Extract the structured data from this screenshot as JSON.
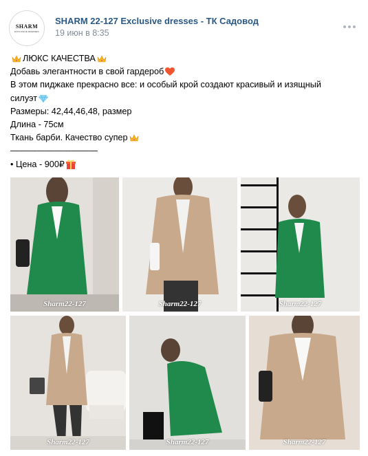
{
  "post": {
    "avatar_brand": "SHARM",
    "avatar_sub": "EXCLUSIVE DRESSES",
    "author": "SHARM 22-127 Exclusive dresses - ТК Садовод",
    "date": "19 июн в 8:35"
  },
  "text": {
    "line1": "ЛЮКС КАЧЕСТВА",
    "line2": "Добавь элегантности в свой гардероб",
    "line3": "В этом пиджаке прекрасно все: и особый крой создают красивый и изящный",
    "line4": "силуэт",
    "line5": "Размеры: 42,44,46,48, размер",
    "line6": "Длина - 75см",
    "line7": "Ткань барби. Качество супер",
    "line8": "——————————",
    "line9": "• Цена - 900₽"
  },
  "icons": {
    "crown": "crown-icon",
    "heart": "heart-icon",
    "gem": "gem-icon",
    "gift": "gift-icon",
    "more": "more-dots-icon"
  },
  "colors": {
    "author": "#2a5885",
    "date": "#818c99",
    "green_blazer": "#1f8a4c",
    "beige_blazer": "#c9a98c"
  },
  "gallery": {
    "watermarks": [
      "Sharm22-127",
      "Sharm22-127",
      "Sharm22-127",
      "Sharm22-127",
      "Sharm22-127",
      "Sharm22-127"
    ]
  }
}
